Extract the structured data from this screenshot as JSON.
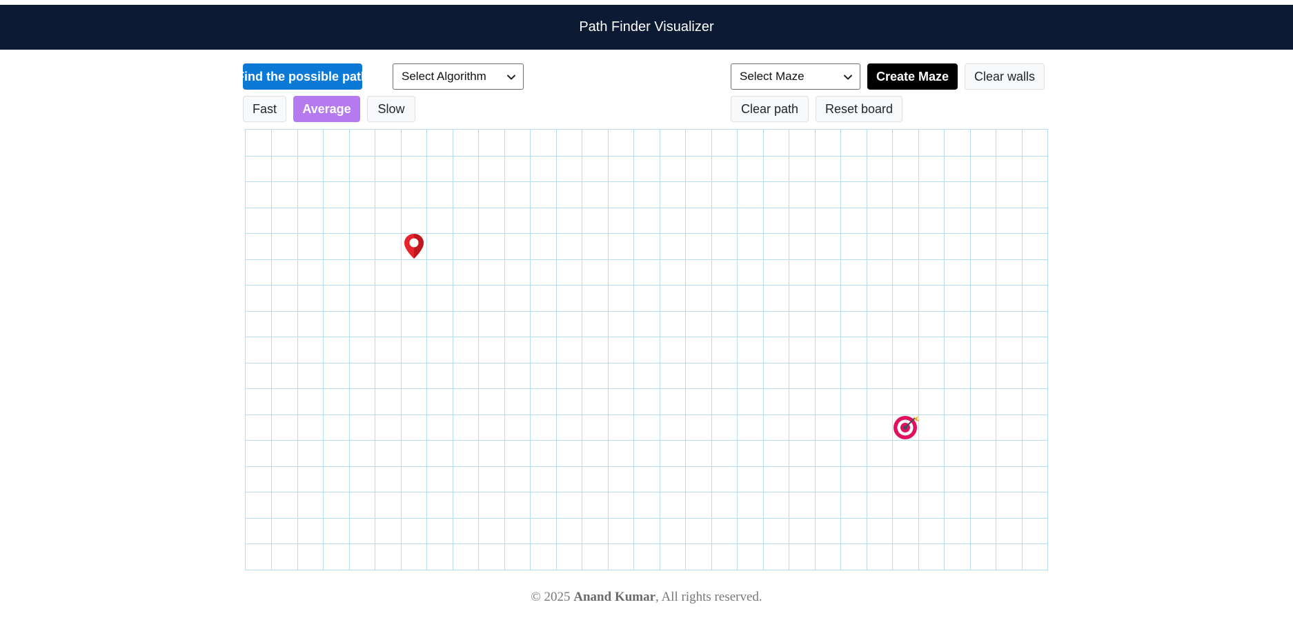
{
  "header": {
    "title": "Path Finder Visualizer"
  },
  "toolbar": {
    "find_path_label": "Find the possible path",
    "algorithm_select": {
      "selected": "Select Algorithm"
    },
    "maze_select": {
      "selected": "Select Maze"
    },
    "create_maze_label": "Create Maze",
    "clear_walls_label": "Clear walls",
    "clear_path_label": "Clear path",
    "reset_board_label": "Reset board",
    "speed": {
      "options": [
        "Fast",
        "Average",
        "Slow"
      ],
      "selected": "Average"
    }
  },
  "board": {
    "rows": 17,
    "cols": 31,
    "start": {
      "icon": "map-pin-icon",
      "row": 4,
      "col": 6
    },
    "target": {
      "icon": "target-icon",
      "row": 11,
      "col": 25
    }
  },
  "colors": {
    "header_bg": "#0c1a33",
    "primary": "#0d79d6",
    "active_speed": "#b57bee",
    "grid_line": "#b6dcf2",
    "start_marker": "#e8222a",
    "target_marker": "#e0115f"
  },
  "footer": {
    "prefix": "© 2025 ",
    "author": "Anand Kumar",
    "suffix": ", All rights reserved."
  }
}
